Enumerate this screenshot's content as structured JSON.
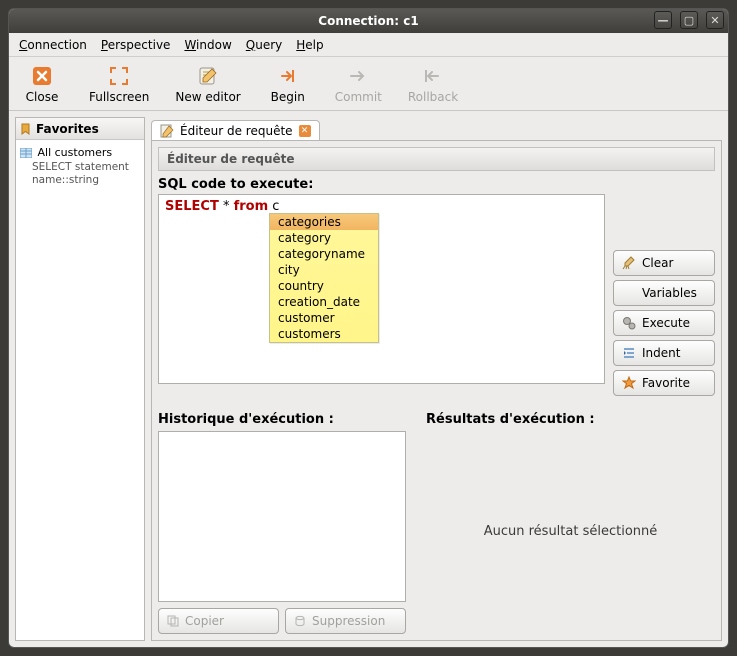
{
  "window": {
    "title": "Connection: c1"
  },
  "menubar": [
    "Connection",
    "Perspective",
    "Window",
    "Query",
    "Help"
  ],
  "toolbar": [
    {
      "label": "Close",
      "icon": "close-icon",
      "enabled": true
    },
    {
      "label": "Fullscreen",
      "icon": "fullscreen-icon",
      "enabled": true
    },
    {
      "label": "New editor",
      "icon": "new-editor-icon",
      "enabled": true
    },
    {
      "label": "Begin",
      "icon": "begin-icon",
      "enabled": true
    },
    {
      "label": "Commit",
      "icon": "commit-icon",
      "enabled": false
    },
    {
      "label": "Rollback",
      "icon": "rollback-icon",
      "enabled": false
    }
  ],
  "sidebar": {
    "title": "Favorites",
    "items": [
      {
        "label": "All customers",
        "sub": "SELECT statement name::string"
      }
    ]
  },
  "tab": {
    "label": "Éditeur de requête"
  },
  "editor": {
    "header_title": "Éditeur de requête",
    "sql_label": "SQL code to execute:",
    "sql_parts": {
      "select": "SELECT",
      "star_from": " * from ",
      "tail": "c"
    },
    "autocomplete": [
      "categories",
      "category",
      "categoryname",
      "city",
      "country",
      "creation_date",
      "customer",
      "customers"
    ],
    "autocomplete_selected_index": 0,
    "buttons": {
      "clear": "Clear",
      "variables": "Variables",
      "execute": "Execute",
      "indent": "Indent",
      "favorite": "Favorite"
    },
    "history_label": "Historique d'exécution :",
    "results_label": "Résultats d'exécution :",
    "no_result": "Aucun résultat sélectionné",
    "copy_btn": "Copier",
    "delete_btn": "Suppression"
  }
}
